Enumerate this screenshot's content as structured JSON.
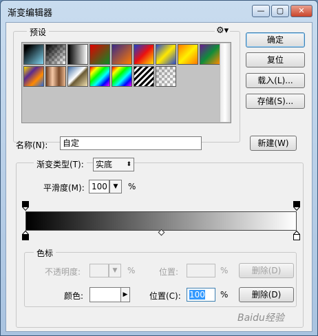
{
  "window": {
    "title": "渐变编辑器"
  },
  "titlebar": {
    "minimize": "—",
    "maximize": "▢",
    "close": "✕"
  },
  "buttons": {
    "ok": "确定",
    "reset": "复位",
    "load": "载入(L)...",
    "save": "存储(S)...",
    "new": "新建(W)"
  },
  "presets": {
    "label": "预设",
    "menu_icon": "gear-icon",
    "swatches": [
      {
        "name": "foreground-to-background",
        "css": "linear-gradient(135deg,#000 0%,#000 15%,#7fd4f0 100%)"
      },
      {
        "name": "foreground-to-transparent",
        "css": "linear-gradient(135deg,#000 0%,rgba(0,0,0,0) 100%)",
        "checker": true
      },
      {
        "name": "black-white",
        "css": "linear-gradient(90deg,#000,#fff)"
      },
      {
        "name": "red-green",
        "css": "linear-gradient(135deg,#e10000,#0b8a26)"
      },
      {
        "name": "violet-orange",
        "css": "linear-gradient(135deg,#3a2a88,#ff7b00)"
      },
      {
        "name": "blue-red-yellow",
        "css": "linear-gradient(135deg,#1b3fcf,#ea1010,#ffe200)"
      },
      {
        "name": "blue-yellow-blue",
        "css": "linear-gradient(135deg,#2a4bd0,#ffe800,#2a4bd0)"
      },
      {
        "name": "orange-yellow-orange",
        "css": "linear-gradient(135deg,#ff7800,#fff000,#ff7800)"
      },
      {
        "name": "violet-green-orange",
        "css": "linear-gradient(135deg,#6a1a92,#0f8c3a,#ff8a00)"
      },
      {
        "name": "yellow-violet-orange-blue",
        "css": "linear-gradient(135deg,#ffe000,#5a2a90,#ff8a00,#2a6ae0)"
      },
      {
        "name": "copper",
        "css": "linear-gradient(90deg,#6b3a1c,#f6c8a6,#7b4a2a,#e9b890)"
      },
      {
        "name": "chrome",
        "css": "linear-gradient(135deg,#3f6ea6,#ffffff 45%,#6a5a34 55%,#f0e0b0)"
      },
      {
        "name": "spectrum",
        "css": "linear-gradient(135deg,#ff0000,#ffff00,#00ff00,#00ffff,#0000ff,#ff00ff)"
      },
      {
        "name": "transparent-rainbow",
        "css": "linear-gradient(135deg,#ff0000,#ffff00,#00ff00,#00ffff,#0000ff,#ff00ff)"
      },
      {
        "name": "transparent-stripes",
        "css": "repeating-linear-gradient(135deg,#000 0 3px,#fff 3px 6px)"
      },
      {
        "name": "neutral-density",
        "css": "linear-gradient(135deg,rgba(0,0,0,0.15),rgba(0,0,0,0))",
        "checker": true
      }
    ]
  },
  "name_row": {
    "label": "名称(N):",
    "value": "自定"
  },
  "gradient_type": {
    "label": "渐变类型(T):",
    "value": "实底"
  },
  "smoothness": {
    "label": "平滑度(M):",
    "value": "100",
    "unit": "%"
  },
  "gradient": {
    "css": "linear-gradient(90deg,#000000,#ffffff)",
    "opacity_stops": [
      0,
      1
    ],
    "color_stops": [
      0,
      1
    ],
    "midpoint": 0.5
  },
  "stops": {
    "label": "色标",
    "opacity_label": "不透明度:",
    "opacity_value": "",
    "opacity_unit": "%",
    "opacity_location_label": "位置:",
    "opacity_location_value": "",
    "opacity_location_unit": "%",
    "opacity_delete": "删除(D)",
    "color_label": "颜色:",
    "color_location_label": "位置(C):",
    "color_location_value": "100",
    "color_location_unit": "%",
    "color_delete": "删除(D)"
  },
  "watermark": {
    "text": "Baidu经验"
  }
}
